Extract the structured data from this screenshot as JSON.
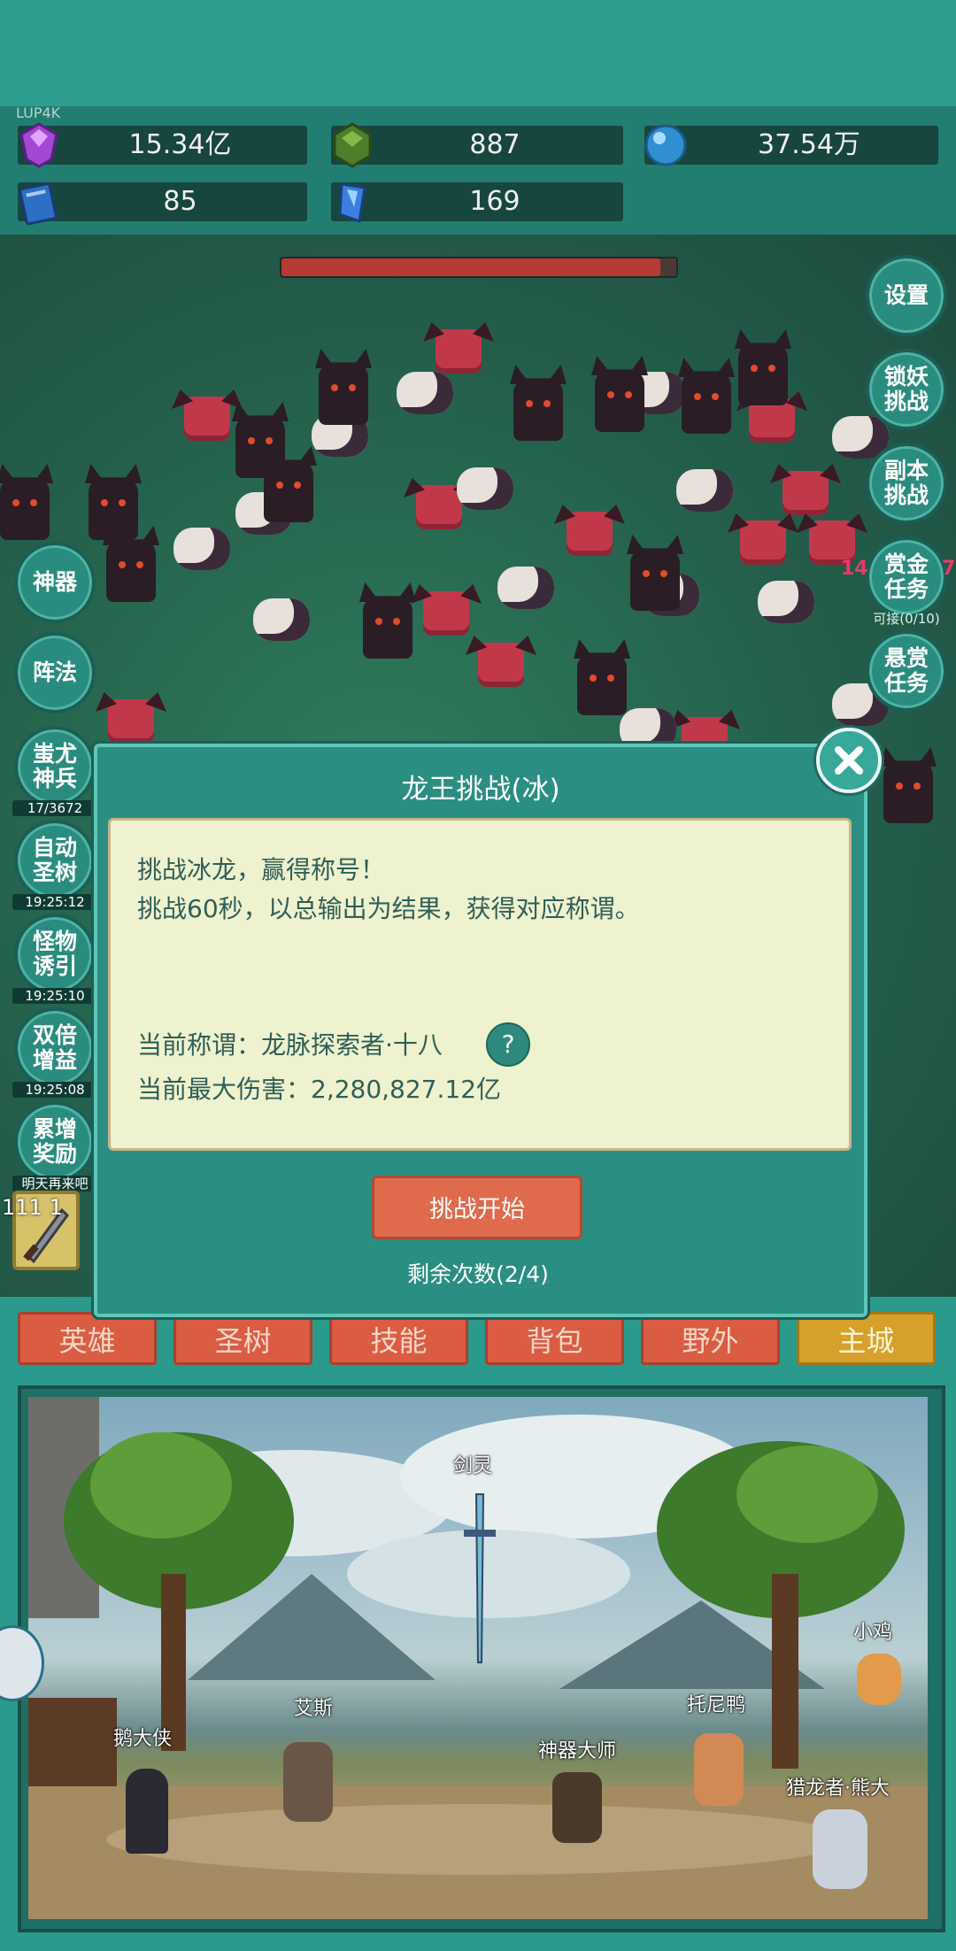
{
  "header": {
    "tag": "LUP4K"
  },
  "resources": [
    {
      "icon": "purple-gem-icon",
      "value": "15.34亿"
    },
    {
      "icon": "green-crystal-icon",
      "value": "887"
    },
    {
      "icon": "blue-orb-icon",
      "value": "37.54万"
    },
    {
      "icon": "blue-book-icon",
      "value": "85"
    },
    {
      "icon": "blue-shard-icon",
      "value": "169"
    }
  ],
  "boss": {
    "hp_fraction": 0.96
  },
  "right_buttons": [
    {
      "label": "设置",
      "sub": ""
    },
    {
      "label": "锁妖\n挑战",
      "sub": ""
    },
    {
      "label": "副本\n挑战",
      "sub": ""
    },
    {
      "label": "赏金\n任务",
      "sub": "可接(0/10)"
    },
    {
      "label": "悬赏\n任务",
      "sub": ""
    }
  ],
  "left_buttons": [
    {
      "label": "神器",
      "sub": ""
    },
    {
      "label": "阵法",
      "sub": ""
    },
    {
      "label": "蚩尤\n神兵",
      "sub": "17/3672"
    },
    {
      "label": "自动\n圣树",
      "sub": "19:25:12"
    },
    {
      "label": "怪物\n诱引",
      "sub": "19:25:10"
    },
    {
      "label": "双倍\n增益",
      "sub": "19:25:08"
    },
    {
      "label": "累增\n奖励",
      "sub": "明天再来吧"
    }
  ],
  "side_numbers": {
    "left": "14",
    "right": "7"
  },
  "slot": {
    "level": "111 1"
  },
  "dialog": {
    "title": "龙王挑战(冰)",
    "line1": "挑战冰龙，赢得称号！",
    "line2": "挑战60秒，以总输出为结果，获得对应称谓。",
    "title_label": "当前称谓：龙脉探索者·十八",
    "help": "?",
    "damage_label": "当前最大伤害：2,280,827.12亿",
    "start": "挑战开始",
    "remaining": "剩余次数(2/4)"
  },
  "tabs": [
    {
      "label": "英雄",
      "active": false
    },
    {
      "label": "圣树",
      "active": false
    },
    {
      "label": "技能",
      "active": false
    },
    {
      "label": "背包",
      "active": false
    },
    {
      "label": "野外",
      "active": false
    },
    {
      "label": "主城",
      "active": true
    }
  ],
  "npcs": [
    {
      "name": "剑灵"
    },
    {
      "name": "小鸡"
    },
    {
      "name": "艾斯"
    },
    {
      "name": "托尼鸭"
    },
    {
      "name": "鹅大侠"
    },
    {
      "name": "神器大师"
    },
    {
      "name": "猎龙者·熊大"
    }
  ],
  "colors": {
    "accent": "#2a9a8c",
    "tab": "#d95c43",
    "tab_active": "#d6a02a",
    "panel": "#eef2cf"
  }
}
